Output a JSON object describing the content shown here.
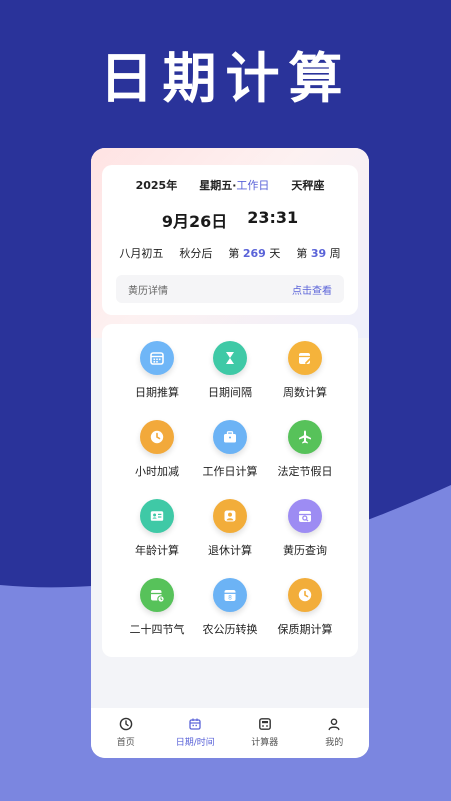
{
  "hero_title": "日期计算",
  "info": {
    "year": "2025年",
    "weekday": "星期五·",
    "workday": "工作日",
    "zodiac": "天秤座",
    "date": "9月26日",
    "time": "23:31",
    "lunar": "八月初五",
    "solar_term": "秋分后",
    "day_prefix": "第",
    "day_num": "269",
    "day_suffix": "天",
    "week_prefix": "第",
    "week_num": "39",
    "week_suffix": "周",
    "almanac_label": "黄历详情",
    "almanac_link": "点击查看"
  },
  "tools": [
    {
      "label": "日期推算",
      "icon": "calendar-grid-icon",
      "color": "#6fb6f7"
    },
    {
      "label": "日期间隔",
      "icon": "hourglass-icon",
      "color": "#3fc9a6"
    },
    {
      "label": "周数计算",
      "icon": "calendar-edit-icon",
      "color": "#f5b33b"
    },
    {
      "label": "小时加减",
      "icon": "clock-icon",
      "color": "#f2a93b"
    },
    {
      "label": "工作日计算",
      "icon": "briefcase-icon",
      "color": "#6cb3f5"
    },
    {
      "label": "法定节假日",
      "icon": "airplane-icon",
      "color": "#57c25a"
    },
    {
      "label": "年龄计算",
      "icon": "id-card-icon",
      "color": "#3fc9a6"
    },
    {
      "label": "退休计算",
      "icon": "person-icon",
      "color": "#f2ad3a"
    },
    {
      "label": "黄历查询",
      "icon": "calendar-search-icon",
      "color": "#9d8cf3"
    },
    {
      "label": "二十四节气",
      "icon": "calendar-clock-icon",
      "color": "#57c25a"
    },
    {
      "label": "农公历转换",
      "icon": "calendar-8-icon",
      "color": "#6cb3f5"
    },
    {
      "label": "保质期计算",
      "icon": "clock-icon",
      "color": "#f2ad3a"
    }
  ],
  "nav": [
    {
      "label": "首页",
      "icon": "clock-icon"
    },
    {
      "label": "日期/时间",
      "icon": "calendar-icon"
    },
    {
      "label": "计算器",
      "icon": "calculator-icon"
    },
    {
      "label": "我的",
      "icon": "user-icon"
    }
  ],
  "colors": {
    "accent": "#5a63d8",
    "hero_bg": "#2a339a",
    "wave": "#7b86e0"
  }
}
